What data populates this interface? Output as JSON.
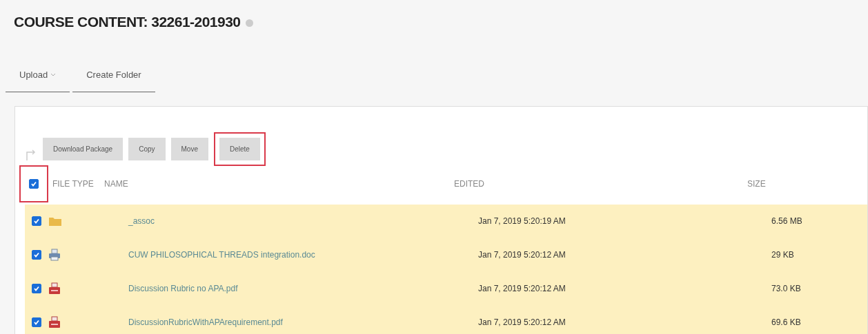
{
  "title": "COURSE CONTENT: 32261-201930",
  "tabs": [
    {
      "label": "Upload",
      "dropdown": true,
      "selected": false
    },
    {
      "label": "Create Folder",
      "dropdown": false,
      "selected": false
    }
  ],
  "actions": [
    {
      "label": "Download Package",
      "highlighted": false
    },
    {
      "label": "Copy",
      "highlighted": false
    },
    {
      "label": "Move",
      "highlighted": false
    },
    {
      "label": "Delete",
      "highlighted": true
    }
  ],
  "select_all": {
    "checked": true,
    "highlighted": true
  },
  "columns": [
    "FILE TYPE",
    "NAME",
    "EDITED",
    "SIZE"
  ],
  "rows": [
    {
      "kind": "folder",
      "name": "_assoc",
      "edited": "Jan 7, 2019 5:20:19 AM",
      "size": "6.56 MB",
      "selected": true
    },
    {
      "kind": "doc",
      "name": "CUW PHILOSOPHICAL THREADS integration.doc",
      "edited": "Jan 7, 2019 5:20:12 AM",
      "size": "29 KB",
      "selected": true
    },
    {
      "kind": "pdf",
      "name": "Discussion Rubric no APA.pdf",
      "edited": "Jan 7, 2019 5:20:12 AM",
      "size": "73.0 KB",
      "selected": true
    },
    {
      "kind": "pdf",
      "name": "DiscussionRubricWithAPArequirement.pdf",
      "edited": "Jan 7, 2019 5:20:12 AM",
      "size": "69.6 KB",
      "selected": true
    }
  ]
}
